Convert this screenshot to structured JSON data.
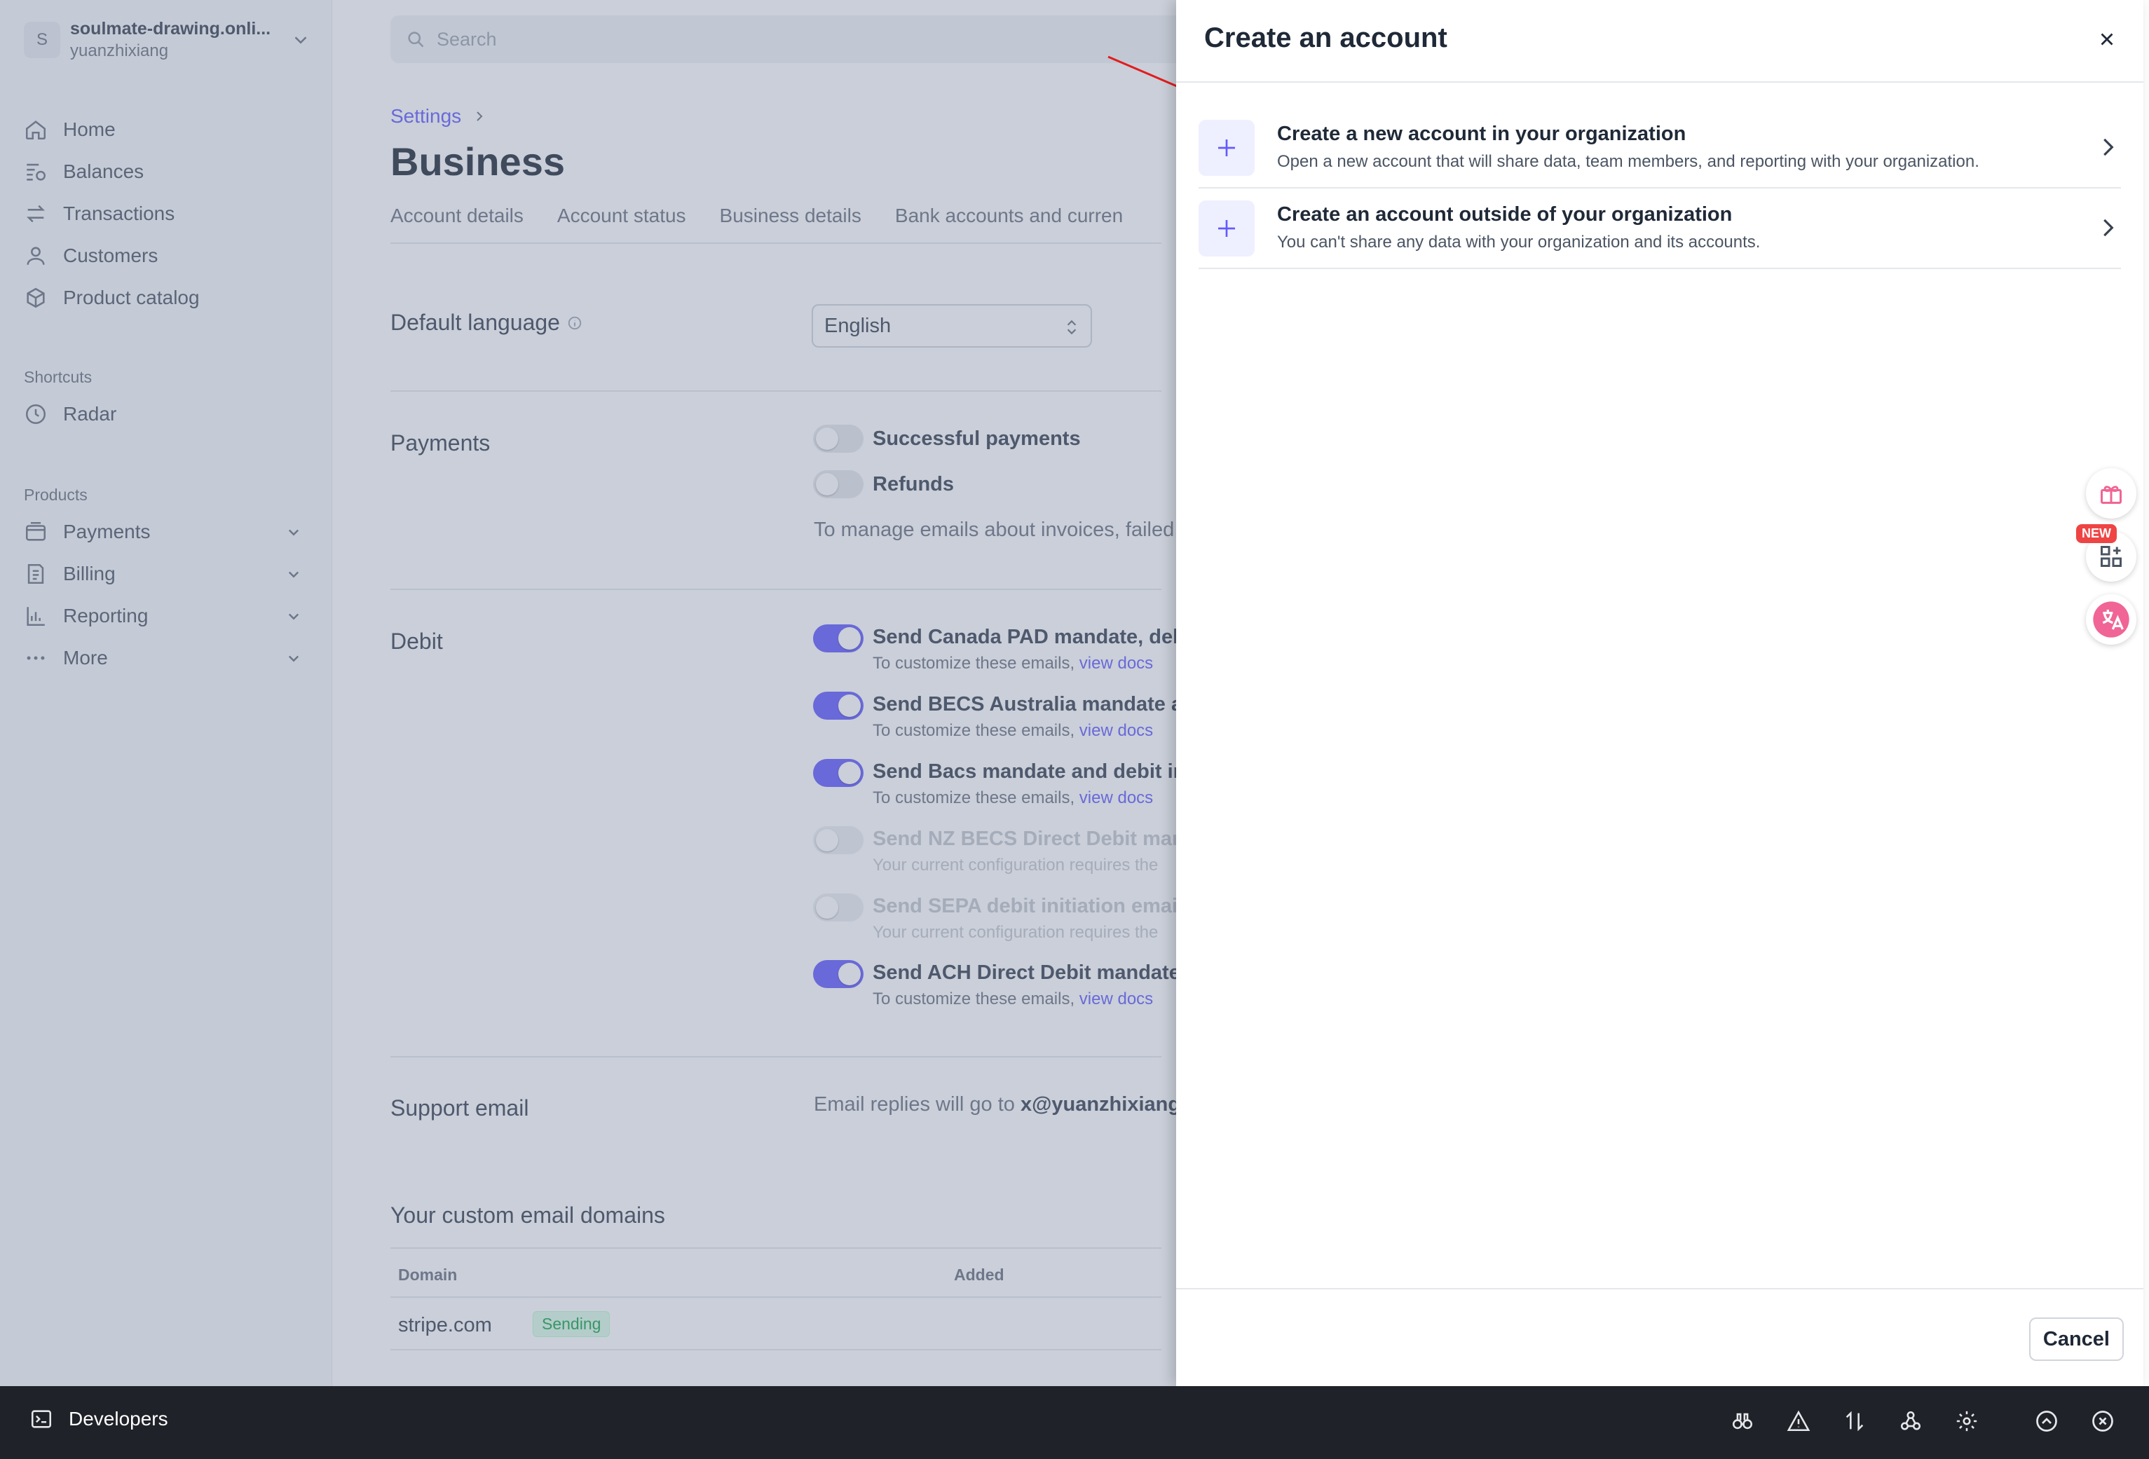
{
  "account": {
    "initial": "S",
    "name": "soulmate-drawing.onli...",
    "user": "yuanzhixiang"
  },
  "nav": {
    "items": [
      {
        "label": "Home",
        "icon": "home-icon"
      },
      {
        "label": "Balances",
        "icon": "balances-icon"
      },
      {
        "label": "Transactions",
        "icon": "transactions-icon"
      },
      {
        "label": "Customers",
        "icon": "customers-icon"
      },
      {
        "label": "Product catalog",
        "icon": "product-catalog-icon"
      }
    ],
    "shortcuts_heading": "Shortcuts",
    "shortcuts": [
      {
        "label": "Radar",
        "icon": "radar-icon"
      }
    ],
    "products_heading": "Products",
    "products": [
      {
        "label": "Payments",
        "icon": "payments-icon"
      },
      {
        "label": "Billing",
        "icon": "billing-icon"
      },
      {
        "label": "Reporting",
        "icon": "reporting-icon"
      },
      {
        "label": "More",
        "icon": "more-icon"
      }
    ]
  },
  "search": {
    "placeholder": "Search"
  },
  "breadcrumb": {
    "settings": "Settings"
  },
  "page": {
    "title": "Business",
    "tabs": [
      "Account details",
      "Account status",
      "Business details",
      "Bank accounts and curren"
    ]
  },
  "settings": {
    "default_language": {
      "label": "Default language",
      "value": "English"
    },
    "payments": {
      "label": "Payments",
      "options": [
        {
          "label": "Successful payments",
          "on": false
        },
        {
          "label": "Refunds",
          "on": false
        }
      ],
      "note": "To manage emails about invoices, failed"
    },
    "debit": {
      "label": "Debit",
      "options": [
        {
          "title": "Send Canada PAD mandate, deb",
          "sub": "To customize these emails,",
          "link": "view docs",
          "on": true,
          "disabled": false
        },
        {
          "title": "Send BECS Australia mandate ar",
          "sub": "To customize these emails,",
          "link": "view docs",
          "on": true,
          "disabled": false
        },
        {
          "title": "Send Bacs mandate and debit in",
          "sub": "To customize these emails,",
          "link": "view docs",
          "on": true,
          "disabled": false
        },
        {
          "title": "Send NZ BECS Direct Debit man",
          "sub": "Your current configuration requires the",
          "link": "",
          "on": false,
          "disabled": true
        },
        {
          "title": "Send SEPA debit initiation email",
          "sub": "Your current configuration requires the",
          "link": "",
          "on": false,
          "disabled": true
        },
        {
          "title": "Send ACH Direct Debit mandate",
          "sub": "To customize these emails,",
          "link": "view docs",
          "on": true,
          "disabled": false
        }
      ]
    },
    "support_email": {
      "label": "Support email",
      "text": "Email replies will go to",
      "email": "x@yuanzhixiang"
    },
    "custom_domains": {
      "label": "Your custom email domains",
      "headers": {
        "domain": "Domain",
        "added": "Added"
      },
      "rows": [
        {
          "domain": "stripe.com",
          "status": "Sending"
        }
      ]
    }
  },
  "drawer": {
    "title": "Create an account",
    "options": [
      {
        "title": "Create a new account in your organization",
        "subtitle": "Open a new account that will share data, team members, and reporting with your organization."
      },
      {
        "title": "Create an account outside of your organization",
        "subtitle": "You can't share any data with your organization and its accounts."
      }
    ],
    "cancel_label": "Cancel"
  },
  "floating": {
    "new_badge": "NEW"
  },
  "devbar": {
    "label": "Developers",
    "tools": [
      "inspect-icon",
      "warning-icon",
      "sort-icon",
      "webhooks-icon",
      "settings-icon",
      "expand-up-icon",
      "close-circle-icon"
    ]
  },
  "colors": {
    "accent": "#635bff",
    "annotation_arrow": "#e11d1d",
    "devbar": "#1f2228"
  }
}
